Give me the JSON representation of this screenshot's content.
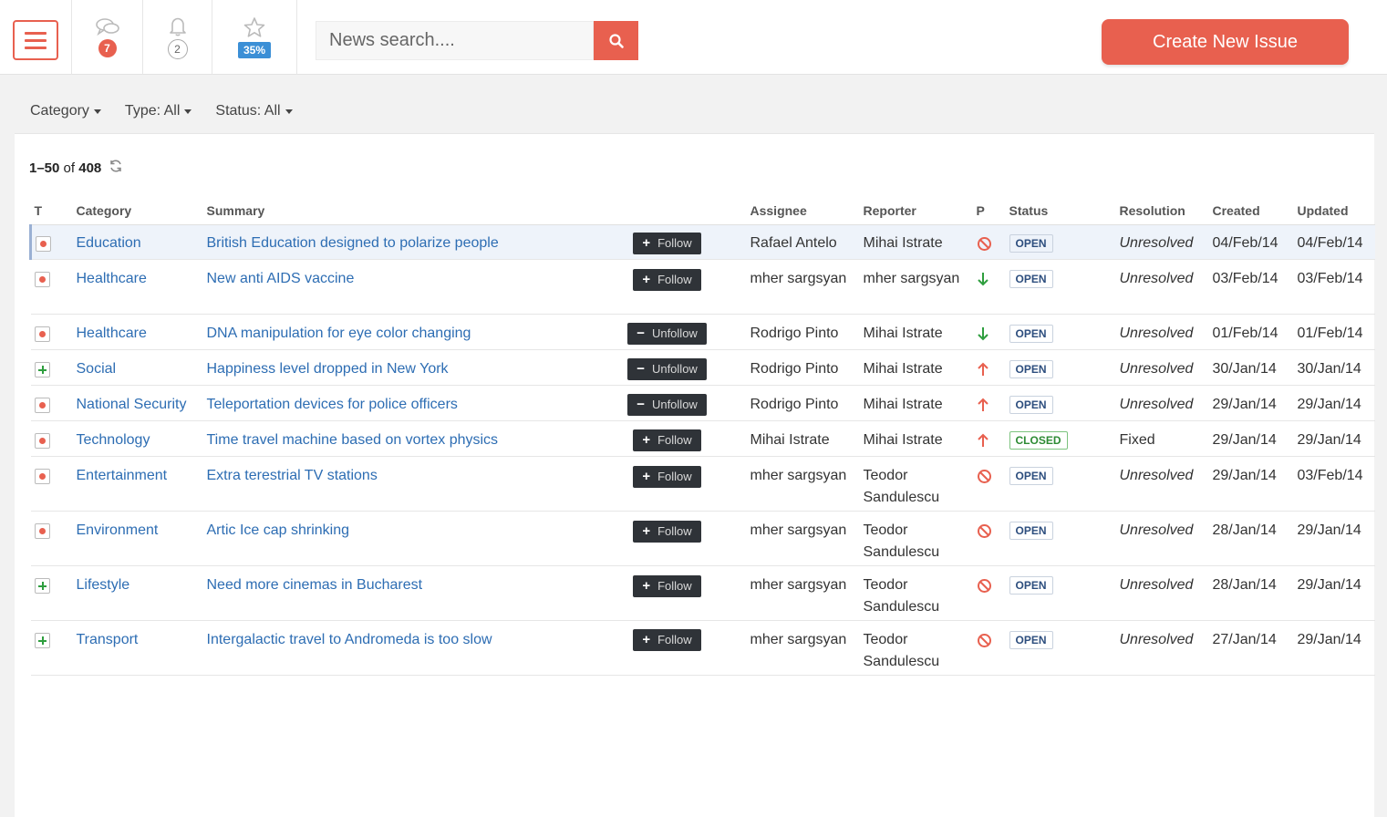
{
  "header": {
    "messages_count": "7",
    "notifications_count": "2",
    "progress_label": "35%",
    "search_placeholder": "News search....",
    "create_button": "Create New Issue"
  },
  "filters": {
    "category": "Category",
    "type": "Type: All",
    "status": "Status: All"
  },
  "list": {
    "range": "1–50",
    "of": "of",
    "total": "408"
  },
  "table": {
    "headers": {
      "t": "T",
      "category": "Category",
      "summary": "Summary",
      "assignee": "Assignee",
      "reporter": "Reporter",
      "p": "P",
      "status": "Status",
      "resolution": "Resolution",
      "created": "Created",
      "updated": "Updated"
    },
    "rows": [
      {
        "type": "bug-icon",
        "category": "Education",
        "summary": "British Education designed to polarize people",
        "follow": "Follow",
        "assignee": "Rafael Antelo",
        "reporter": "Mihai Istrate",
        "priority": "blocker-icon",
        "status": "OPEN",
        "resolution": "Unresolved",
        "created": "04/Feb/14",
        "updated": "04/Feb/14"
      },
      {
        "type": "bug-icon",
        "category": "Healthcare",
        "summary": "New anti AIDS vaccine",
        "follow": "Follow",
        "assignee": "mher sargsyan",
        "reporter": "mher sargsyan",
        "priority": "arrow-down-icon",
        "status": "OPEN",
        "resolution": "Unresolved",
        "created": "03/Feb/14",
        "updated": "03/Feb/14"
      },
      {
        "type": "bug-icon",
        "category": "Healthcare",
        "summary": "DNA manipulation for eye color changing",
        "follow": "Unfollow",
        "assignee": "Rodrigo Pinto",
        "reporter": "Mihai Istrate",
        "priority": "arrow-down-icon",
        "status": "OPEN",
        "resolution": "Unresolved",
        "created": "01/Feb/14",
        "updated": "01/Feb/14"
      },
      {
        "type": "plus-icon",
        "category": "Social",
        "summary": "Happiness level dropped in New York",
        "follow": "Unfollow",
        "assignee": "Rodrigo Pinto",
        "reporter": "Mihai Istrate",
        "priority": "arrow-up-icon",
        "status": "OPEN",
        "resolution": "Unresolved",
        "created": "30/Jan/14",
        "updated": "30/Jan/14"
      },
      {
        "type": "bug-icon",
        "category": "National Security",
        "summary": "Teleportation devices for police officers",
        "follow": "Unfollow",
        "assignee": "Rodrigo Pinto",
        "reporter": "Mihai Istrate",
        "priority": "arrow-up-icon",
        "status": "OPEN",
        "resolution": "Unresolved",
        "created": "29/Jan/14",
        "updated": "29/Jan/14"
      },
      {
        "type": "bug-icon",
        "category": "Technology",
        "summary": "Time travel machine based on vortex physics",
        "follow": "Follow",
        "assignee": "Mihai Istrate",
        "reporter": "Mihai Istrate",
        "priority": "arrow-up-icon",
        "status": "CLOSED",
        "resolution": "Fixed",
        "created": "29/Jan/14",
        "updated": "29/Jan/14"
      },
      {
        "type": "bug-icon",
        "category": "Entertainment",
        "summary": "Extra terestrial TV stations",
        "follow": "Follow",
        "assignee": "mher sargsyan",
        "reporter": "Teodor Sandulescu",
        "priority": "blocker-icon",
        "status": "OPEN",
        "resolution": "Unresolved",
        "created": "29/Jan/14",
        "updated": "03/Feb/14"
      },
      {
        "type": "bug-icon",
        "category": "Environment",
        "summary": "Artic Ice cap shrinking",
        "follow": "Follow",
        "assignee": "mher sargsyan",
        "reporter": "Teodor Sandulescu",
        "priority": "blocker-icon",
        "status": "OPEN",
        "resolution": "Unresolved",
        "created": "28/Jan/14",
        "updated": "29/Jan/14"
      },
      {
        "type": "plus-icon",
        "category": "Lifestyle",
        "summary": "Need more cinemas in Bucharest",
        "follow": "Follow",
        "assignee": "mher sargsyan",
        "reporter": "Teodor Sandulescu",
        "priority": "blocker-icon",
        "status": "OPEN",
        "resolution": "Unresolved",
        "created": "28/Jan/14",
        "updated": "29/Jan/14"
      },
      {
        "type": "plus-icon",
        "category": "Transport",
        "summary": "Intergalactic travel to Andromeda is too slow",
        "follow": "Follow",
        "assignee": "mher sargsyan",
        "reporter": "Teodor Sandulescu",
        "priority": "blocker-icon",
        "status": "OPEN",
        "resolution": "Unresolved",
        "created": "27/Jan/14",
        "updated": "29/Jan/14"
      }
    ]
  },
  "colors": {
    "accent": "#e8604f",
    "link": "#2d6db3",
    "badge_blue": "#3b8fd6",
    "priority_up": "#e8604f",
    "priority_down": "#2e9e3e"
  }
}
